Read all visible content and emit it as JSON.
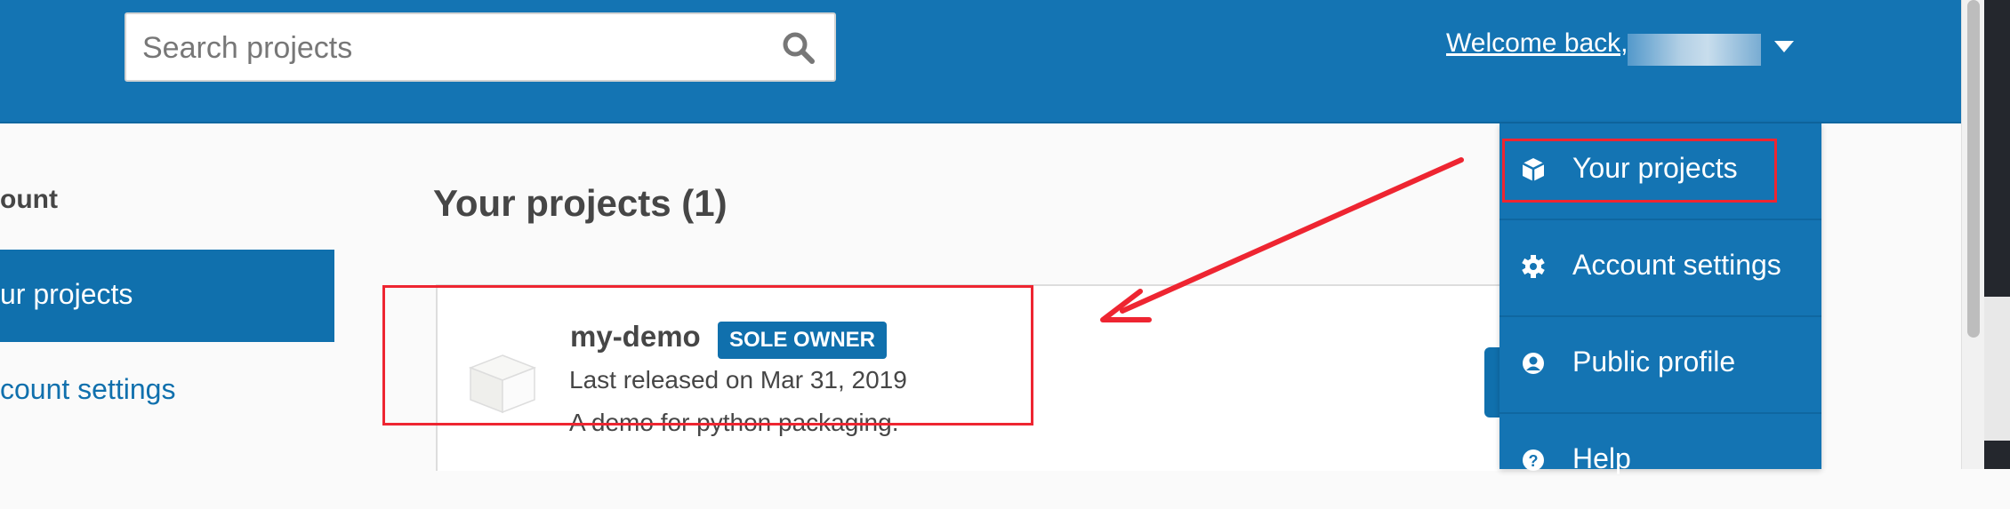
{
  "header": {
    "search": {
      "placeholder": "Search projects",
      "value": "",
      "icon": "search-icon"
    },
    "welcome_label": "Welcome back,",
    "username_redacted": true
  },
  "sidebar": {
    "heading": "ount",
    "items": [
      {
        "label": "ur projects",
        "active": true
      },
      {
        "label": "count settings",
        "active": false
      }
    ]
  },
  "main": {
    "title": "Your projects (1)",
    "projects": [
      {
        "name": "my-demo",
        "badge": "SOLE OWNER",
        "released": "Last released on Mar 31, 2019",
        "description": "A demo for python packaging.",
        "icon": "package-cube-icon"
      }
    ]
  },
  "dropdown": {
    "items": [
      {
        "label": "Your projects",
        "icon": "cube-icon"
      },
      {
        "label": "Account settings",
        "icon": "gear-icon"
      },
      {
        "label": "Public profile",
        "icon": "user-circle-icon"
      },
      {
        "label": "Help",
        "icon": "question-circle-icon"
      }
    ]
  },
  "annotations": {
    "highlight_color": "#ee2531"
  },
  "colors": {
    "brand": "#1474b3",
    "accent": "#1070ad",
    "text": "#464646"
  }
}
